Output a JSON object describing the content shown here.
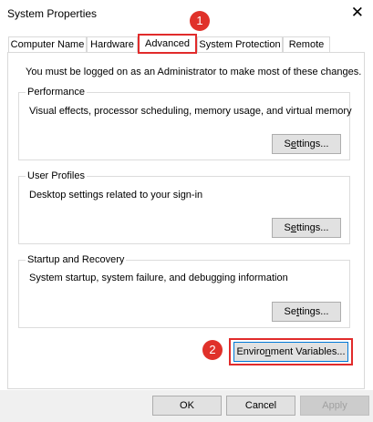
{
  "window": {
    "title": "System Properties",
    "close_glyph": "✕"
  },
  "tabs": [
    "Computer Name",
    "Hardware",
    "Advanced",
    "System Protection",
    "Remote"
  ],
  "active_tab": "Advanced",
  "notice": "You must be logged on as an Administrator to make most of these changes.",
  "groups": {
    "performance": {
      "title": "Performance",
      "desc": "Visual effects, processor scheduling, memory usage, and virtual memory",
      "button": {
        "pre": "S",
        "ul": "e",
        "post": "ttings..."
      }
    },
    "user_profiles": {
      "title": "User Profiles",
      "desc": "Desktop settings related to your sign-in",
      "button": {
        "pre": "S",
        "ul": "e",
        "post": "ttings..."
      }
    },
    "startup": {
      "title": "Startup and Recovery",
      "desc": "System startup, system failure, and debugging information",
      "button": {
        "pre": "Se",
        "ul": "t",
        "post": "tings..."
      }
    }
  },
  "env_button": {
    "pre": "Enviro",
    "ul": "n",
    "post": "ment Variables..."
  },
  "dialog_buttons": {
    "ok": "OK",
    "cancel": "Cancel",
    "apply": "Apply"
  },
  "annotations": {
    "badge1": "1",
    "badge2": "2",
    "color": "#e0312a"
  }
}
